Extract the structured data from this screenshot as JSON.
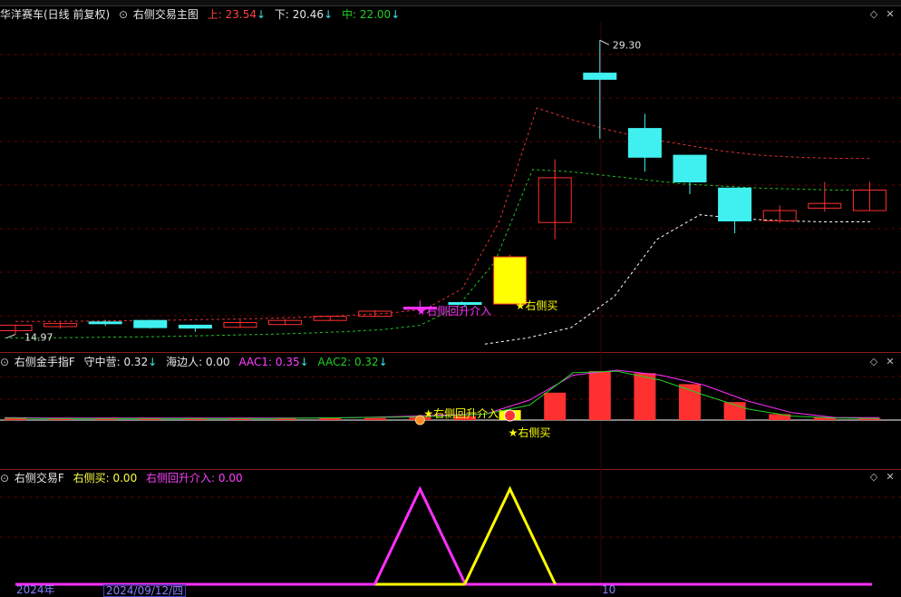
{
  "main": {
    "stock_title": "华洋赛车(日线 前复权)",
    "indicator_name": "右侧交易主图",
    "upper_text": "上: 23.54",
    "upper_arrow": "↓",
    "lower_text": "下: 20.46",
    "lower_arrow": "↓",
    "mid_text": "中: 22.00",
    "mid_arrow": "↓"
  },
  "pane2": {
    "name": "右侧金手指F",
    "v1_text": "守中营: 0.32",
    "v1_arrow": "↓",
    "v2_text": "海边人: 0.00",
    "v3_text": "AAC1: 0.35",
    "v3_arrow": "↓",
    "v4_text": "AAC2: 0.32",
    "v4_arrow": "↓"
  },
  "pane3": {
    "name": "右侧交易F",
    "v1_text": "右侧买: 0.00",
    "v2_text": "右侧回升介入: 0.00"
  },
  "axis": {
    "year_label": "2024年",
    "cursor_date": "2024/09/12/四",
    "month_label": "10"
  },
  "colors": {
    "up": "#ff3030",
    "down": "#40f0f0",
    "magenta": "#ff30ff",
    "yellow": "#ffff00",
    "white": "#ffffff",
    "green": "#20d020",
    "grid": "#6e0000"
  },
  "chart_data": {
    "type": "candlestick",
    "price_range": [
      14.2,
      30.2
    ],
    "max_label": "29.30",
    "max_value": 29.3,
    "min_label": "14.97",
    "min_value": 14.97,
    "candles": [
      {
        "o": 15.15,
        "h": 15.45,
        "l": 14.97,
        "c": 15.42,
        "bar": "up"
      },
      {
        "o": 15.35,
        "h": 15.55,
        "l": 15.25,
        "c": 15.5,
        "bar": "up"
      },
      {
        "o": 15.58,
        "h": 15.68,
        "l": 15.38,
        "c": 15.5,
        "bar": "down"
      },
      {
        "o": 15.65,
        "h": 15.68,
        "l": 15.25,
        "c": 15.3,
        "bar": "down"
      },
      {
        "o": 15.42,
        "h": 15.45,
        "l": 15.1,
        "c": 15.28,
        "bar": "down"
      },
      {
        "o": 15.32,
        "h": 15.68,
        "l": 15.3,
        "c": 15.55,
        "bar": "up"
      },
      {
        "o": 15.45,
        "h": 15.72,
        "l": 15.42,
        "c": 15.65,
        "bar": "up"
      },
      {
        "o": 15.65,
        "h": 15.88,
        "l": 15.62,
        "c": 15.85,
        "bar": "up"
      },
      {
        "o": 15.85,
        "h": 16.15,
        "l": 15.82,
        "c": 16.1,
        "bar": "up"
      },
      {
        "o": 16.3,
        "h": 16.62,
        "l": 16.1,
        "c": 16.2,
        "bar": "magenta"
      },
      {
        "o": 16.52,
        "h": 16.55,
        "l": 16.3,
        "c": 16.48,
        "bar": "down"
      },
      {
        "o": 16.45,
        "h": 18.85,
        "l": 16.45,
        "c": 18.75,
        "bar": "yellow"
      },
      {
        "o": 20.42,
        "h": 23.5,
        "l": 19.6,
        "c": 22.6,
        "bar": "up"
      },
      {
        "o": 27.7,
        "h": 29.3,
        "l": 24.5,
        "c": 27.4,
        "bar": "down"
      },
      {
        "o": 25.0,
        "h": 25.72,
        "l": 22.9,
        "c": 23.6,
        "bar": "down"
      },
      {
        "o": 23.7,
        "h": 23.7,
        "l": 21.8,
        "c": 22.4,
        "bar": "down"
      },
      {
        "o": 22.1,
        "h": 22.05,
        "l": 19.9,
        "c": 20.5,
        "bar": "down"
      },
      {
        "o": 20.5,
        "h": 21.25,
        "l": 20.4,
        "c": 21.0,
        "bar": "up"
      },
      {
        "o": 21.12,
        "h": 22.4,
        "l": 20.95,
        "c": 21.35,
        "bar": "up"
      },
      {
        "o": 21.0,
        "h": 22.4,
        "l": 21.0,
        "c": 22.0,
        "bar": "up"
      }
    ],
    "upper_band": [
      15.6,
      15.6,
      15.62,
      15.64,
      15.66,
      15.69,
      15.72,
      15.76,
      15.82,
      15.9,
      16.0,
      16.2,
      17.2,
      20.5,
      26.0,
      25.4,
      24.9,
      24.5,
      24.2,
      23.9,
      23.7,
      23.6,
      23.55,
      23.54
    ],
    "mid_band": [
      14.8,
      14.8,
      14.82,
      14.84,
      14.86,
      14.9,
      14.94,
      14.98,
      15.03,
      15.1,
      15.2,
      15.4,
      16.3,
      18.5,
      23.0,
      22.9,
      22.7,
      22.5,
      22.3,
      22.2,
      22.1,
      22.05,
      22.0,
      22.0
    ],
    "lower_band": [
      14.5,
      14.8,
      15.3,
      16.8,
      19.6,
      20.8,
      20.6,
      20.5,
      20.45,
      20.46
    ],
    "signals": [
      {
        "text": "★右侧回升介入",
        "series": "右侧回升介入",
        "candle": 9
      },
      {
        "text": "★右侧买",
        "series": "右侧买",
        "candle": 11
      }
    ],
    "pane2": {
      "bars": [
        0.05,
        0.04,
        0.04,
        0.04,
        0.03,
        0.04,
        0.04,
        0.04,
        0.04,
        0.06,
        0.08,
        0.2,
        0.55,
        0.98,
        0.94,
        0.72,
        0.36,
        0.12,
        0.06,
        0.04
      ],
      "aac1": [
        0.05,
        0.04,
        0.04,
        0.04,
        0.04,
        0.04,
        0.04,
        0.04,
        0.05,
        0.07,
        0.1,
        0.12,
        0.4,
        0.9,
        1.0,
        0.9,
        0.7,
        0.38,
        0.15,
        0.05,
        0.05
      ],
      "aac2": [
        0.04,
        0.03,
        0.03,
        0.03,
        0.03,
        0.03,
        0.03,
        0.04,
        0.05,
        0.06,
        0.08,
        0.12,
        0.3,
        0.95,
        0.98,
        0.8,
        0.5,
        0.22,
        0.08,
        0.04,
        0.03
      ]
    },
    "pane3": {
      "right_rebound_peak_at": 9,
      "right_buy_peak_at": 11
    }
  }
}
